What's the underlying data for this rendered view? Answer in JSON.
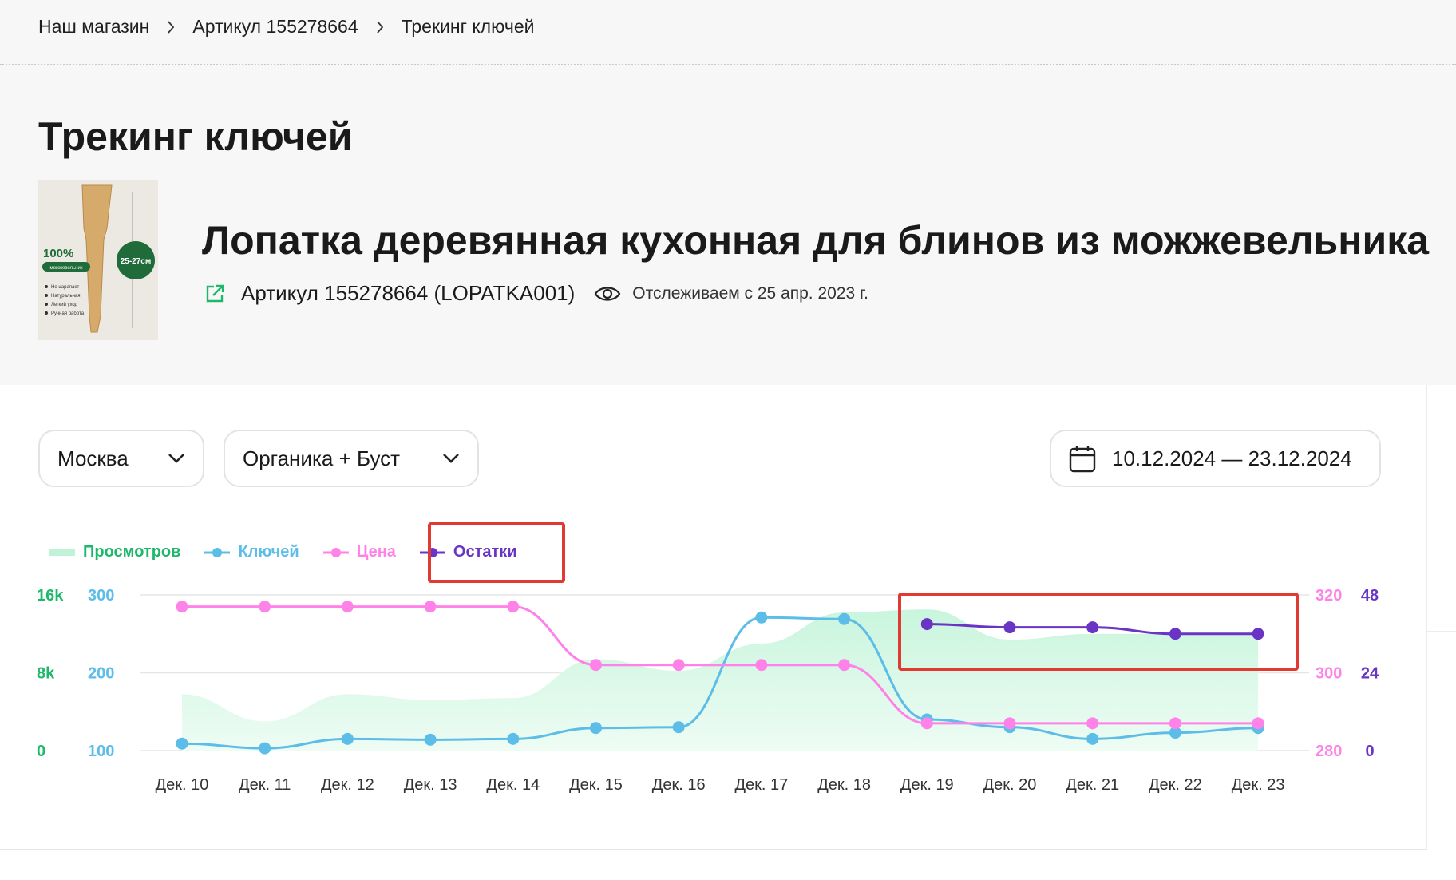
{
  "breadcrumb": {
    "items": [
      "Наш магазин",
      "Артикул 155278664",
      "Трекинг ключей"
    ]
  },
  "page_title": "Трекинг ключей",
  "product": {
    "title": "Лопатка деревянная кухонная для блинов из можжевельника",
    "article": "Артикул 155278664 (LOPATKA001)",
    "tracking_since": "Отслеживаем с 25 апр. 2023 г.",
    "image": {
      "badge": "100%",
      "badge_sub": "можжевельник",
      "size": "25-27см",
      "features": [
        "Не царапает",
        "Натуральная",
        "Легкий уход",
        "Ручная работа"
      ]
    }
  },
  "filters": {
    "city": "Москва",
    "traffic": "Органика + Буст",
    "date_range": "10.12.2024 — 23.12.2024"
  },
  "legend": {
    "views": "Просмотров",
    "keys": "Ключей",
    "price": "Цена",
    "stock": "Остатки"
  },
  "colors": {
    "views": "#1db86a",
    "views_fill": "#d6f7e4",
    "keys": "#5bbde8",
    "price": "#ff82e8",
    "stock": "#6a35c4",
    "highlight": "#e03a32"
  },
  "chart_data": {
    "type": "line",
    "categories": [
      "Дек. 10",
      "Дек. 11",
      "Дек. 12",
      "Дек. 13",
      "Дек. 14",
      "Дек. 15",
      "Дек. 16",
      "Дек. 17",
      "Дек. 18",
      "Дек. 19",
      "Дек. 20",
      "Дек. 21",
      "Дек. 22",
      "Дек. 23"
    ],
    "axes": {
      "views": {
        "ticks": [
          "16k",
          "8k",
          "0"
        ],
        "ylim": [
          0,
          16000
        ]
      },
      "keys": {
        "ticks": [
          "300",
          "200",
          "100"
        ],
        "ylim": [
          100,
          300
        ]
      },
      "price": {
        "ticks": [
          "320",
          "300",
          "280"
        ],
        "ylim": [
          280,
          320
        ]
      },
      "stock": {
        "ticks": [
          "48",
          "24",
          "0"
        ],
        "ylim": [
          0,
          48
        ]
      }
    },
    "series": [
      {
        "name": "Просмотров",
        "type": "area",
        "axis": "views",
        "values": [
          5800,
          3000,
          5800,
          5200,
          5400,
          9400,
          8200,
          11000,
          14200,
          14500,
          11400,
          12000,
          12000,
          12000
        ]
      },
      {
        "name": "Ключей",
        "axis": "keys",
        "values": [
          109,
          103,
          115,
          114,
          115,
          129,
          130,
          271,
          269,
          140,
          130,
          115,
          123,
          129
        ]
      },
      {
        "name": "Цена",
        "axis": "price",
        "values": [
          317,
          317,
          317,
          317,
          317,
          302,
          302,
          302,
          302,
          287,
          287,
          287,
          287,
          287
        ]
      },
      {
        "name": "Остатки",
        "axis": "stock",
        "values": [
          null,
          null,
          null,
          null,
          null,
          null,
          null,
          null,
          null,
          39,
          38,
          38,
          36,
          36
        ]
      }
    ],
    "grid": true
  }
}
